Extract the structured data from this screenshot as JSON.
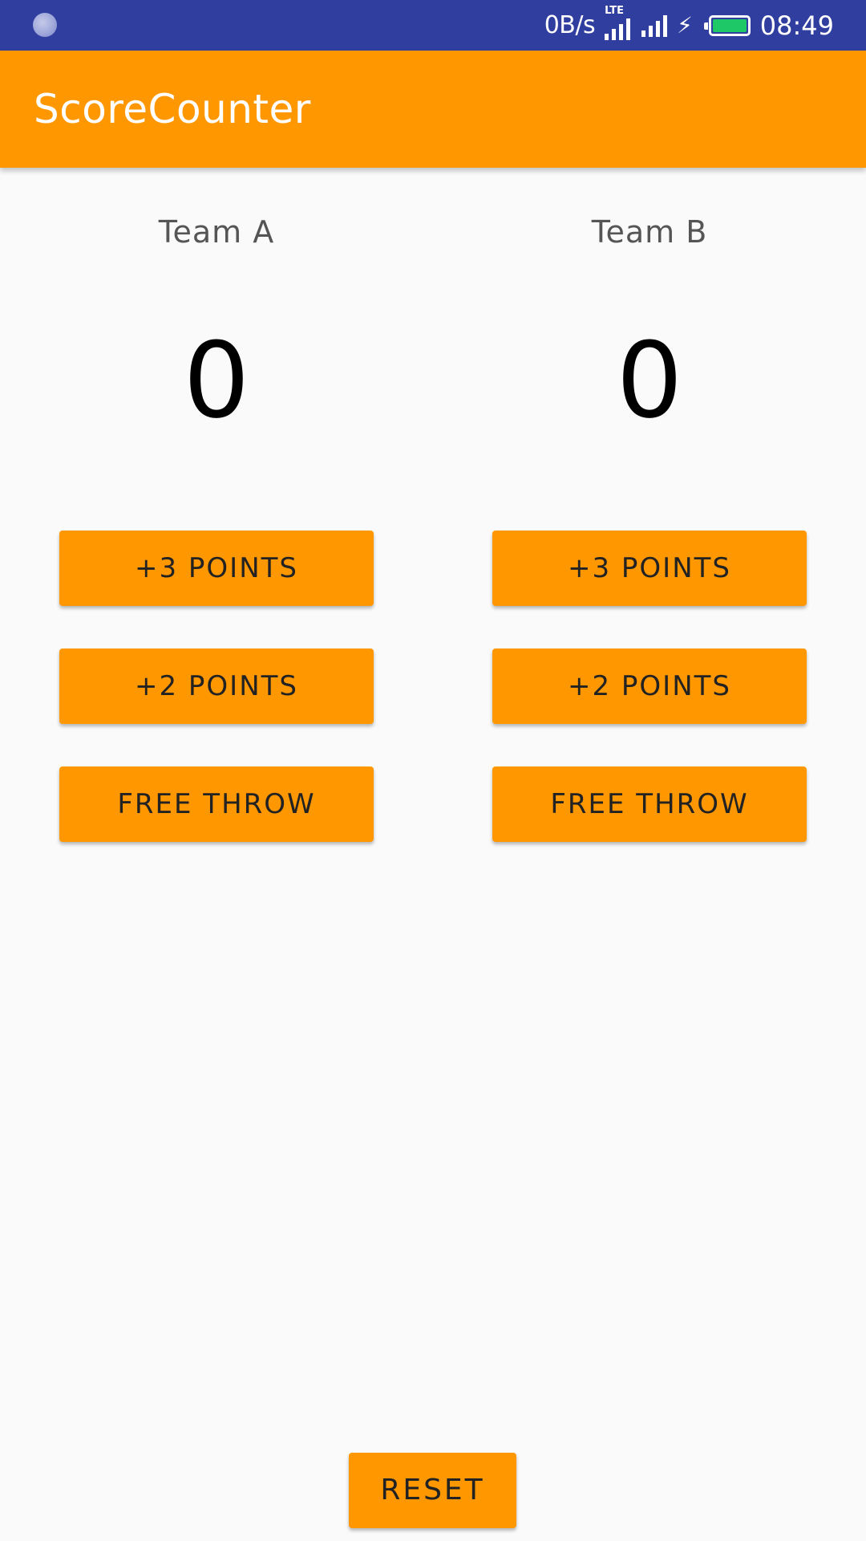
{
  "status_bar": {
    "net_speed": "0B/s",
    "network_type": "LTE",
    "time": "08:49",
    "battery_color": "#1ec866",
    "bar_color": "#303f9f",
    "icons": [
      "notification-spinner-icon",
      "signal-lte-icon",
      "signal-icon",
      "charging-bolt-icon",
      "battery-icon"
    ]
  },
  "app_bar": {
    "title": "ScoreCounter",
    "color": "#ff9800"
  },
  "team_a": {
    "name": "Team A",
    "score": "0",
    "btn_three": "+3 POINTS",
    "btn_two": "+2 POINTS",
    "btn_free": "FREE THROW"
  },
  "team_b": {
    "name": "Team B",
    "score": "0",
    "btn_three": "+3 POINTS",
    "btn_two": "+2 POINTS",
    "btn_free": "FREE THROW"
  },
  "reset_label": "RESET"
}
